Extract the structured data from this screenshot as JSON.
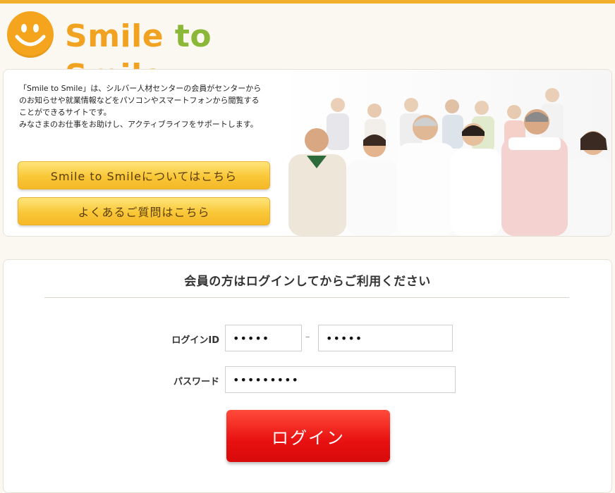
{
  "header": {
    "logo_text_1": "Smile",
    "logo_text_2": "to",
    "logo_text_3": "Smile"
  },
  "intro": {
    "line1": "「Smile to Smile」は、シルバー人材センターの会員がセンターから",
    "line2": "のお知らせや就業情報などをパソコンやスマートフォンから閲覧する",
    "line3": "ことができるサイトです。",
    "line4": "みなさまのお仕事をお助けし、アクティブライフをサポートします。",
    "about_button": "Smile to Smileについてはこちら",
    "faq_button": "よくあるご質問はこちら"
  },
  "login": {
    "heading": "会員の方はログインしてからご利用ください",
    "id_label": "ログインID",
    "id_part1": "•••••",
    "id_separator": "–",
    "id_part2": "•••••",
    "password_label": "パスワード",
    "password_value": "•••••••••",
    "login_button": "ログイン"
  },
  "colors": {
    "accent_orange": "#f5a51d",
    "accent_green": "#8cb83a",
    "button_yellow": "#f9c737",
    "button_red": "#e81111"
  },
  "icons": [
    "smiley-logo-icon"
  ]
}
